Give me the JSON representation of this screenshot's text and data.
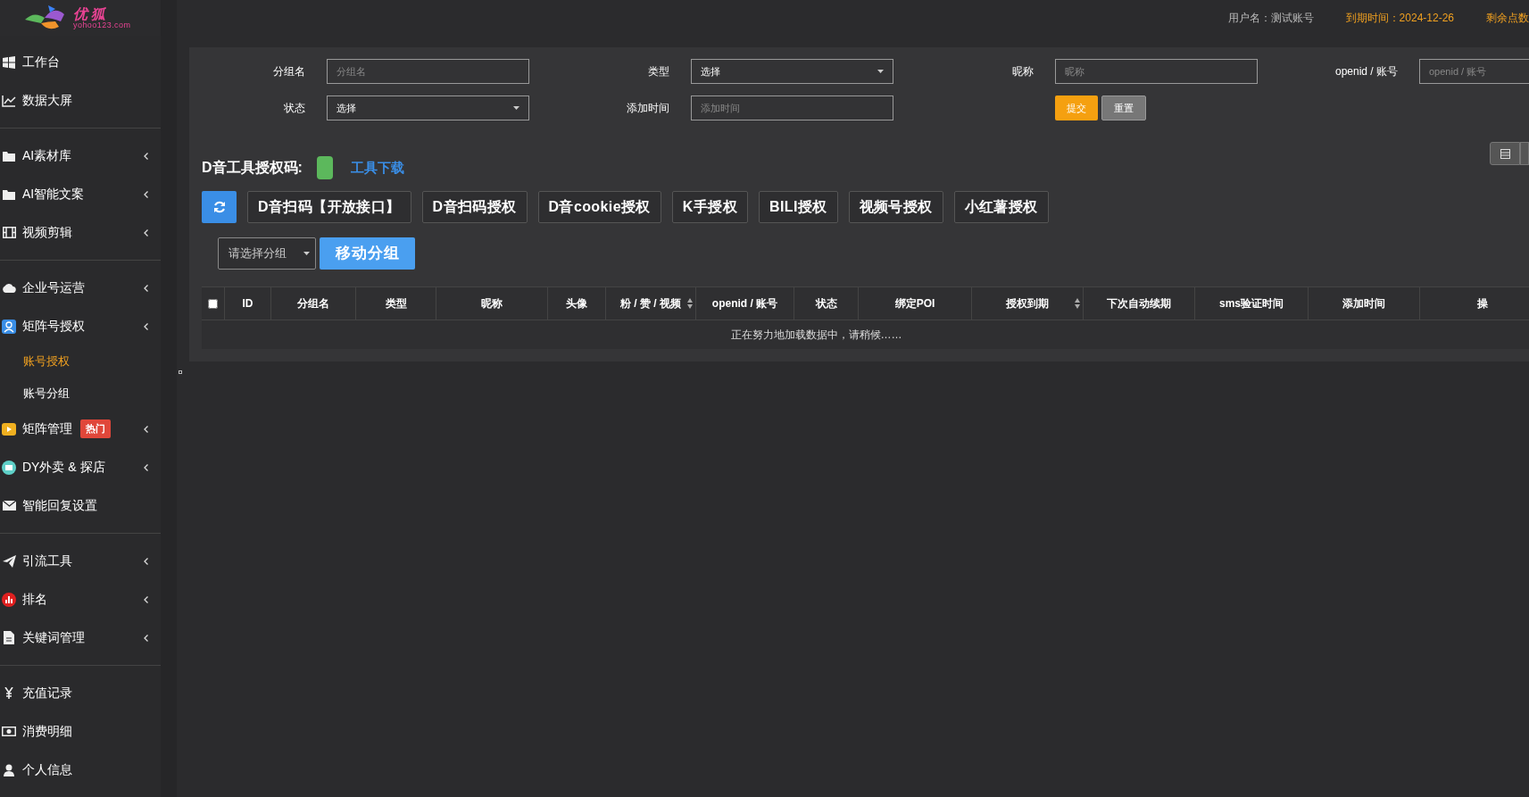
{
  "logo": {
    "name": "优 狐",
    "domain": "yohoo123.com"
  },
  "header": {
    "user": "用户名：测试账号",
    "expiry": "到期时间：2024-12-26",
    "points": "剩余点数"
  },
  "sidebar": {
    "groups": [
      [
        {
          "label": "工作台",
          "collapsible": false,
          "selected": false
        },
        {
          "label": "数据大屏",
          "collapsible": false,
          "selected": false
        }
      ],
      [
        {
          "label": "AI素材库",
          "collapsible": true,
          "selected": false
        },
        {
          "label": "AI智能文案",
          "collapsible": true,
          "selected": false
        },
        {
          "label": "视频剪辑",
          "collapsible": true,
          "selected": false
        }
      ],
      [
        {
          "label": "企业号运营",
          "collapsible": true,
          "selected": false
        },
        {
          "label": "矩阵号授权",
          "collapsible": true,
          "selected": false,
          "children": [
            {
              "label": "账号授权",
              "selected": true
            },
            {
              "label": "账号分组",
              "selected": false
            }
          ]
        },
        {
          "label": "矩阵管理",
          "collapsible": true,
          "selected": false,
          "badge": "热门"
        },
        {
          "label": "DY外卖 & 探店",
          "collapsible": true,
          "selected": false
        },
        {
          "label": "智能回复设置",
          "collapsible": false,
          "selected": false
        }
      ],
      [
        {
          "label": "引流工具",
          "collapsible": true,
          "selected": false
        },
        {
          "label": "排名",
          "collapsible": true,
          "selected": false
        },
        {
          "label": "关键词管理",
          "collapsible": true,
          "selected": false
        }
      ],
      [
        {
          "label": "充值记录",
          "collapsible": false,
          "selected": false
        },
        {
          "label": "消费明细",
          "collapsible": false,
          "selected": false
        },
        {
          "label": "个人信息",
          "collapsible": false,
          "selected": false
        }
      ]
    ]
  },
  "filters": [
    {
      "label": "分组名",
      "kind": "text",
      "placeholder": "分组名"
    },
    {
      "label": "类型",
      "kind": "select",
      "value": "选择"
    },
    {
      "label": "昵称",
      "kind": "text",
      "placeholder": "昵称"
    },
    {
      "label": "openid / 账号",
      "kind": "text",
      "placeholder": "openid / 账号"
    },
    {
      "label": "状态",
      "kind": "select",
      "value": "选择"
    },
    {
      "label": "添加时间",
      "kind": "text",
      "placeholder": "添加时间"
    }
  ],
  "form_buttons": [
    {
      "label": "提交",
      "kind": "primary"
    },
    {
      "label": "重置",
      "kind": "secondary"
    }
  ],
  "auth_code": {
    "label": "D音工具授权码:",
    "link": "工具下载"
  },
  "auth_buttons": [
    "D音扫码【开放接口】",
    "D音扫码授权",
    "D音cookie授权",
    "K手授权",
    "BILI授权",
    "视频号授权",
    "小红薯授权"
  ],
  "group_select": {
    "placeholder": "请选择分组"
  },
  "move_button": "移动分组",
  "table": {
    "columns": [
      {
        "label": "ID",
        "sortable": false
      },
      {
        "label": "分组名",
        "sortable": false
      },
      {
        "label": "类型",
        "sortable": false
      },
      {
        "label": "昵称",
        "sortable": false
      },
      {
        "label": "头像",
        "sortable": false
      },
      {
        "label": "粉 / 赞 / 视频",
        "sortable": true
      },
      {
        "label": "openid / 账号",
        "sortable": false
      },
      {
        "label": "状态",
        "sortable": false
      },
      {
        "label": "绑定POI",
        "sortable": false
      },
      {
        "label": "授权到期",
        "sortable": true
      },
      {
        "label": "下次自动续期",
        "sortable": false
      },
      {
        "label": "sms验证时间",
        "sortable": false
      },
      {
        "label": "添加时间",
        "sortable": false
      },
      {
        "label": "操",
        "sortable": false
      }
    ],
    "select_all": false,
    "message": "正在努力地加载数据中，请稍候……"
  }
}
